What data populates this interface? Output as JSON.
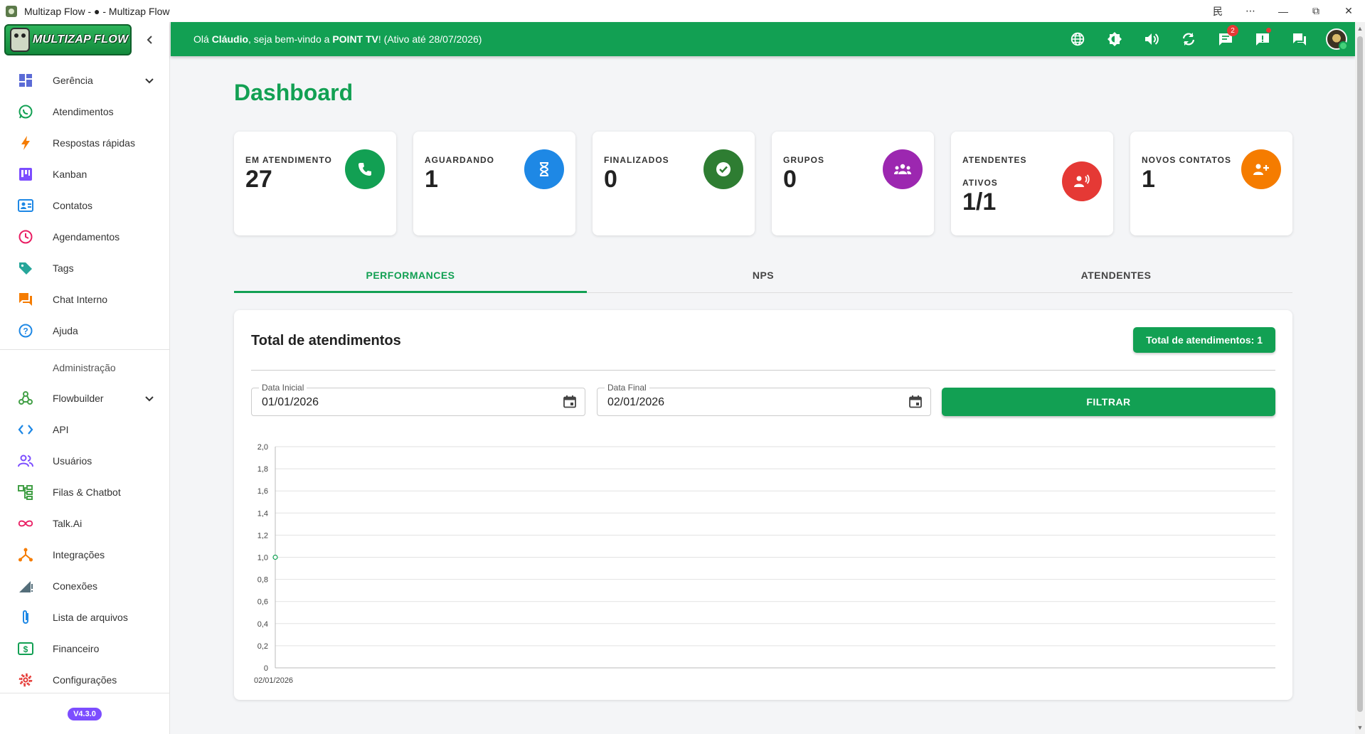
{
  "window": {
    "title": "Multizap Flow - ● - Multizap Flow",
    "controls": [
      "⺠",
      "⋯",
      "—",
      "⧉",
      "✕"
    ]
  },
  "sidebar": {
    "logo_text": "MULTIZAP FLOW",
    "items_top": [
      {
        "label": "Gerência",
        "icon": "dashboard-icon",
        "color": "#5b6bd6",
        "has_chevron": true
      },
      {
        "label": "Atendimentos",
        "icon": "whatsapp-icon",
        "color": "#12a053"
      },
      {
        "label": "Respostas rápidas",
        "icon": "lightning-icon",
        "color": "#f57c00"
      },
      {
        "label": "Kanban",
        "icon": "kanban-icon",
        "color": "#7c4dff"
      },
      {
        "label": "Contatos",
        "icon": "contacts-icon",
        "color": "#1e88e5"
      },
      {
        "label": "Agendamentos",
        "icon": "clock-icon",
        "color": "#e91e63"
      },
      {
        "label": "Tags",
        "icon": "tag-icon",
        "color": "#26a69a"
      },
      {
        "label": "Chat Interno",
        "icon": "chat-icon",
        "color": "#f57c00"
      },
      {
        "label": "Ajuda",
        "icon": "help-icon",
        "color": "#1e88e5"
      }
    ],
    "section_label": "Administração",
    "items_admin": [
      {
        "label": "Flowbuilder",
        "icon": "flowbuilder-icon",
        "color": "#43a047",
        "has_chevron": true
      },
      {
        "label": "API",
        "icon": "code-icon",
        "color": "#1e88e5"
      },
      {
        "label": "Usuários",
        "icon": "users-icon",
        "color": "#7c4dff"
      },
      {
        "label": "Filas & Chatbot",
        "icon": "queue-icon",
        "color": "#43a047"
      },
      {
        "label": "Talk.Ai",
        "icon": "infinity-icon",
        "color": "#e91e63"
      },
      {
        "label": "Integrações",
        "icon": "integrations-icon",
        "color": "#f57c00"
      },
      {
        "label": "Conexões",
        "icon": "signal-icon",
        "color": "#546e7a"
      },
      {
        "label": "Lista de arquivos",
        "icon": "paperclip-icon",
        "color": "#1e88e5"
      },
      {
        "label": "Financeiro",
        "icon": "money-icon",
        "color": "#12a053"
      },
      {
        "label": "Configurações",
        "icon": "gear-icon",
        "color": "#e53935"
      }
    ],
    "version": "V4.3.0"
  },
  "topbar": {
    "greeting_pre": "Olá ",
    "user": "Cláudio",
    "greeting_mid": ", seja bem-vindo a ",
    "company": "POINT TV",
    "greeting_post": "! (Ativo até 28/07/2026)",
    "icons": [
      "globe-icon",
      "brightness-icon",
      "volume-icon",
      "refresh-icon",
      "messages-icon",
      "alert-icon",
      "chat-icon",
      "avatar"
    ],
    "messages_badge": "2"
  },
  "dashboard": {
    "title": "Dashboard",
    "cards": [
      {
        "title": "EM ATENDIMENTO",
        "value": "27",
        "color": "#12a053",
        "icon": "phone-icon"
      },
      {
        "title": "AGUARDANDO",
        "value": "1",
        "color": "#1e88e5",
        "icon": "hourglass-icon"
      },
      {
        "title": "FINALIZADOS",
        "value": "0",
        "color": "#2e7d32",
        "icon": "check-circle-icon"
      },
      {
        "title": "GRUPOS",
        "value": "0",
        "color": "#9c27b0",
        "icon": "groups-icon"
      },
      {
        "title": "ATENDENTES ATIVOS",
        "value": "1/1",
        "color": "#e53935",
        "icon": "speaker-person-icon"
      },
      {
        "title": "NOVOS CONTATOS",
        "value": "1",
        "color": "#f57c00",
        "icon": "person-add-icon"
      }
    ],
    "tabs": [
      "PERFORMANCES",
      "NPS",
      "ATENDENTES"
    ],
    "active_tab": 0
  },
  "panel": {
    "title": "Total de atendimentos",
    "total_label": "Total de atendimentos: 1",
    "date_start": {
      "label": "Data Inicial",
      "value": "01/01/2026"
    },
    "date_end": {
      "label": "Data Final",
      "value": "02/01/2026"
    },
    "filter_label": "FILTRAR"
  },
  "chart_data": {
    "type": "line",
    "x": [
      "02/01/2026"
    ],
    "series": [
      {
        "values": [
          1
        ]
      }
    ],
    "ylim": [
      0,
      2
    ],
    "yticks": [
      "0",
      "0,2",
      "0,4",
      "0,6",
      "0,8",
      "1,0",
      "1,2",
      "1,4",
      "1,6",
      "1,8",
      "2,0"
    ],
    "grid": true,
    "color": "#12a053"
  }
}
